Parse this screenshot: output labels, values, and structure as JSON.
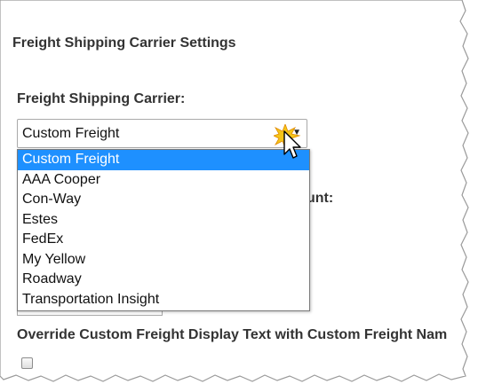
{
  "section_title": "Freight Shipping Carrier Settings",
  "carrier_field": {
    "label": "Freight Shipping Carrier:",
    "selected_value": "Custom Freight",
    "options": [
      "Custom Freight",
      "AAA Cooper",
      "Con-Way",
      "Estes",
      "FedEx",
      "My Yellow",
      "Roadway",
      "Transportation Insight"
    ]
  },
  "partially_hidden_label_tail": "unt:",
  "override_field": {
    "label": "Override Custom Freight Display Text with Custom Freight Nam",
    "checked": false
  },
  "colors": {
    "highlight": "#1e90ff",
    "label_text": "#333333",
    "cursor_burst": "#f5c518"
  },
  "icons": {
    "dropdown_arrow": "triangle-down",
    "cursor": "mouse-pointer-arrow"
  }
}
